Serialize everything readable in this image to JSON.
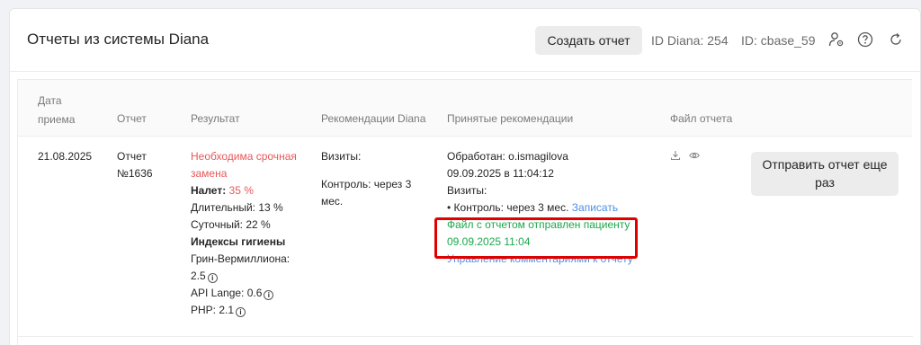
{
  "header": {
    "title": "Отчеты из системы Diana",
    "create_button": "Создать отчет",
    "id_diana": "ID Diana: 254",
    "id_base": "ID: cbase_59",
    "icons": [
      "user-settings-icon",
      "help-icon",
      "refresh-icon"
    ]
  },
  "table": {
    "columns": {
      "date": [
        "Дата",
        "приема"
      ],
      "report": "Отчет",
      "result": "Результат",
      "recommendations": "Рекомендации Diana",
      "accepted": "Принятые рекомендации",
      "file": "Файл отчета"
    },
    "row": {
      "date": "21.08.2025",
      "report": [
        "Отчет",
        "№1636"
      ],
      "result": {
        "urgent": [
          "Необходима срочная",
          "замена"
        ],
        "plaque_label": "Налет:",
        "plaque_value": "35 %",
        "long": "Длительный: 13 %",
        "daily": "Суточный: 22 %",
        "hygiene_title": "Индексы гигиены",
        "green_verm": [
          "Грин-Вермиллиона:",
          "2.5"
        ],
        "api": "API Lange: 0.6",
        "php": "PHP: 2.1",
        "info_symbol": "i"
      },
      "recommendations": {
        "visits": "Визиты:",
        "control": [
          "Контроль: через 3",
          "мес."
        ]
      },
      "accepted": {
        "processed_by": "Обработан: o.ismagilova",
        "processed_at": "09.09.2025 в 11:04:12",
        "visits": "Визиты:",
        "control": "• Контроль: через 3 мес.",
        "record_link": "Записать",
        "sent_line1": "Файл с отчетом отправлен пациенту",
        "sent_line2": "09.09.2025 11:04",
        "manage_link": "Управление комментариями к отчету"
      },
      "file_icons": [
        "download-icon",
        "eye-icon"
      ],
      "resend_button": [
        "Отправить отчет еще",
        "раз"
      ]
    }
  },
  "colors": {
    "urgent": "#e8585b",
    "sent": "#1ba84a",
    "link": "#4a90e2",
    "highlight": "#e00000"
  }
}
